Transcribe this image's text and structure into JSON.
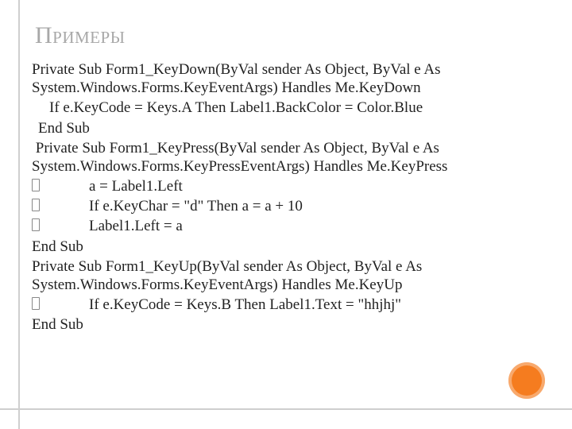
{
  "title": "Примеры",
  "lines": {
    "l1": "Private Sub Form1_KeyDown(ByVal sender As Object, ByVal e As System.Windows.Forms.KeyEventArgs) Handles Me.KeyDown",
    "l2": "If e.KeyCode = Keys.A Then Label1.BackColor = Color.Blue",
    "l3": "End Sub",
    "l4": " Private Sub Form1_KeyPress(ByVal sender As Object, ByVal e As System.Windows.Forms.KeyPressEventArgs) Handles Me.KeyPress",
    "b1": "a = Label1.Left",
    "b2": "If e.KeyChar = \"d\" Then a = a + 10",
    "b3": "Label1.Left = a",
    "l5": "End Sub",
    "l6": "Private Sub Form1_KeyUp(ByVal sender As Object, ByVal e As System.Windows.Forms.KeyEventArgs) Handles Me.KeyUp",
    "b4": "If e.KeyCode = Keys.B Then Label1.Text = \"hhjhj\"",
    "l7": "End Sub"
  }
}
